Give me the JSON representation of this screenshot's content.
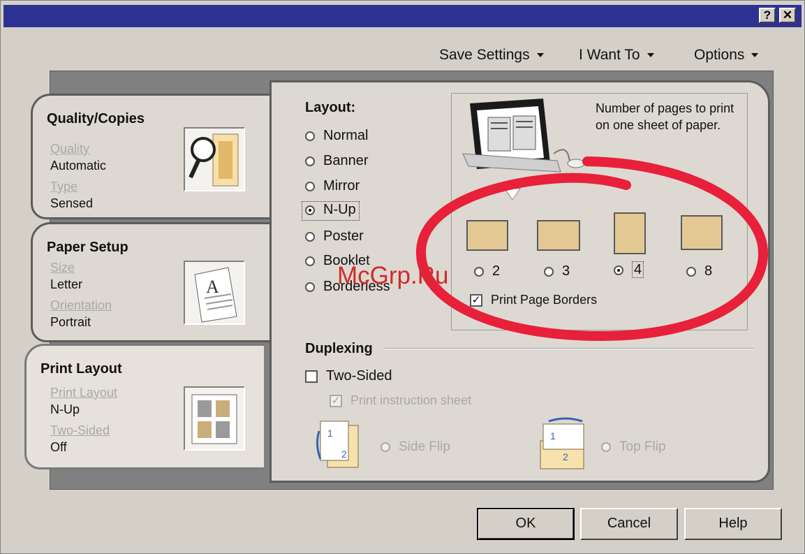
{
  "titlebar": {
    "help_button": "?",
    "close_button": "✕"
  },
  "menu": {
    "save_settings": "Save Settings",
    "i_want_to": "I Want To",
    "options": "Options"
  },
  "tabs": [
    {
      "title": "Quality/Copies",
      "label1": "Quality",
      "value1": "Automatic",
      "label2": "Type",
      "value2": "Sensed"
    },
    {
      "title": "Paper Setup",
      "label1": "Size",
      "value1": "Letter",
      "label2": "Orientation",
      "value2": "Portrait"
    },
    {
      "title": "Print Layout",
      "label1": "Print Layout",
      "value1": "N-Up",
      "label2": "Two-Sided",
      "value2": "Off"
    }
  ],
  "layout": {
    "title": "Layout:",
    "options": [
      "Normal",
      "Banner",
      "Mirror",
      "N-Up",
      "Poster",
      "Booklet",
      "Borderless"
    ],
    "selected": "N-Up"
  },
  "nup": {
    "description": "Number of pages to print on one sheet of paper.",
    "options": [
      "2",
      "3",
      "4",
      "8"
    ],
    "selected": "4",
    "print_page_borders": "Print Page Borders",
    "print_page_borders_checked": true
  },
  "duplexing": {
    "title": "Duplexing",
    "two_sided": "Two-Sided",
    "two_sided_checked": false,
    "print_instruction_sheet": "Print instruction sheet",
    "print_instruction_sheet_checked": true,
    "side_flip": "Side Flip",
    "top_flip": "Top Flip"
  },
  "buttons": {
    "ok": "OK",
    "cancel": "Cancel",
    "help": "Help"
  },
  "watermark": "McGrp.Ru",
  "colors": {
    "titlebar": "#2d3292",
    "window": "#d4d0c8",
    "highlight_ellipse": "#e8203a",
    "watermark": "#d12b2b"
  }
}
